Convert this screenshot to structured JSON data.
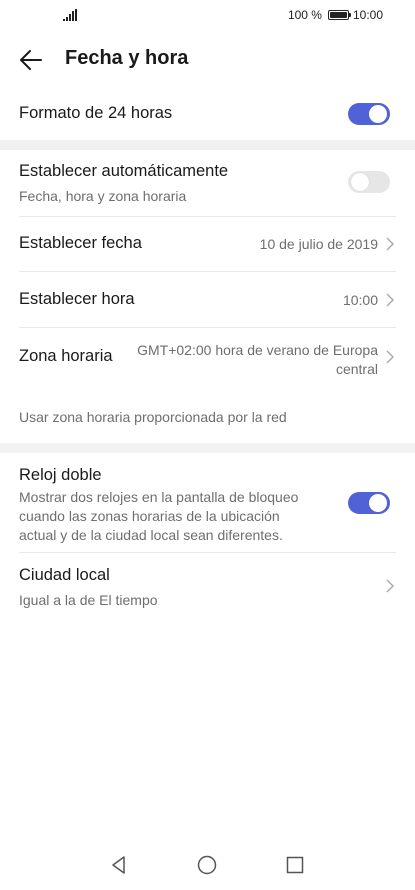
{
  "status_bar": {
    "battery_percent_text": "100 %",
    "battery_level": 1.0,
    "time": "10:00"
  },
  "header": {
    "title": "Fecha y hora",
    "back_icon": "arrow-left-icon"
  },
  "settings": {
    "format_24h": {
      "label": "Formato de 24 horas",
      "enabled": true
    },
    "auto_set": {
      "label": "Establecer automáticamente",
      "subtitle": "Fecha, hora y zona horaria",
      "enabled": false
    },
    "set_date": {
      "label": "Establecer fecha",
      "value": "10 de julio de 2019"
    },
    "set_time": {
      "label": "Establecer hora",
      "value": "10:00"
    },
    "time_zone": {
      "label": "Zona horaria",
      "value_line1": "GMT+02:00 hora de verano de Europa",
      "value_line2": "central"
    },
    "network_tz_note": "Usar zona horaria proporcionada por la red",
    "dual_clock": {
      "label": "Reloj doble",
      "subtitle_line1": "Mostrar dos relojes en la pantalla de bloqueo",
      "subtitle_line2": "cuando las zonas horarias de la ubicación",
      "subtitle_line3": "actual y de la ciudad local sean diferentes.",
      "enabled": true
    },
    "home_city": {
      "label": "Ciudad local",
      "subtitle": "Igual a la de El tiempo"
    }
  },
  "colors": {
    "accent": "#5162d6",
    "toggle_off": "#e6e6e6",
    "section_gap": "#f1f1f1"
  },
  "nav_bar": {
    "back": "triangle-back-icon",
    "home": "circle-home-icon",
    "recents": "square-recents-icon"
  }
}
